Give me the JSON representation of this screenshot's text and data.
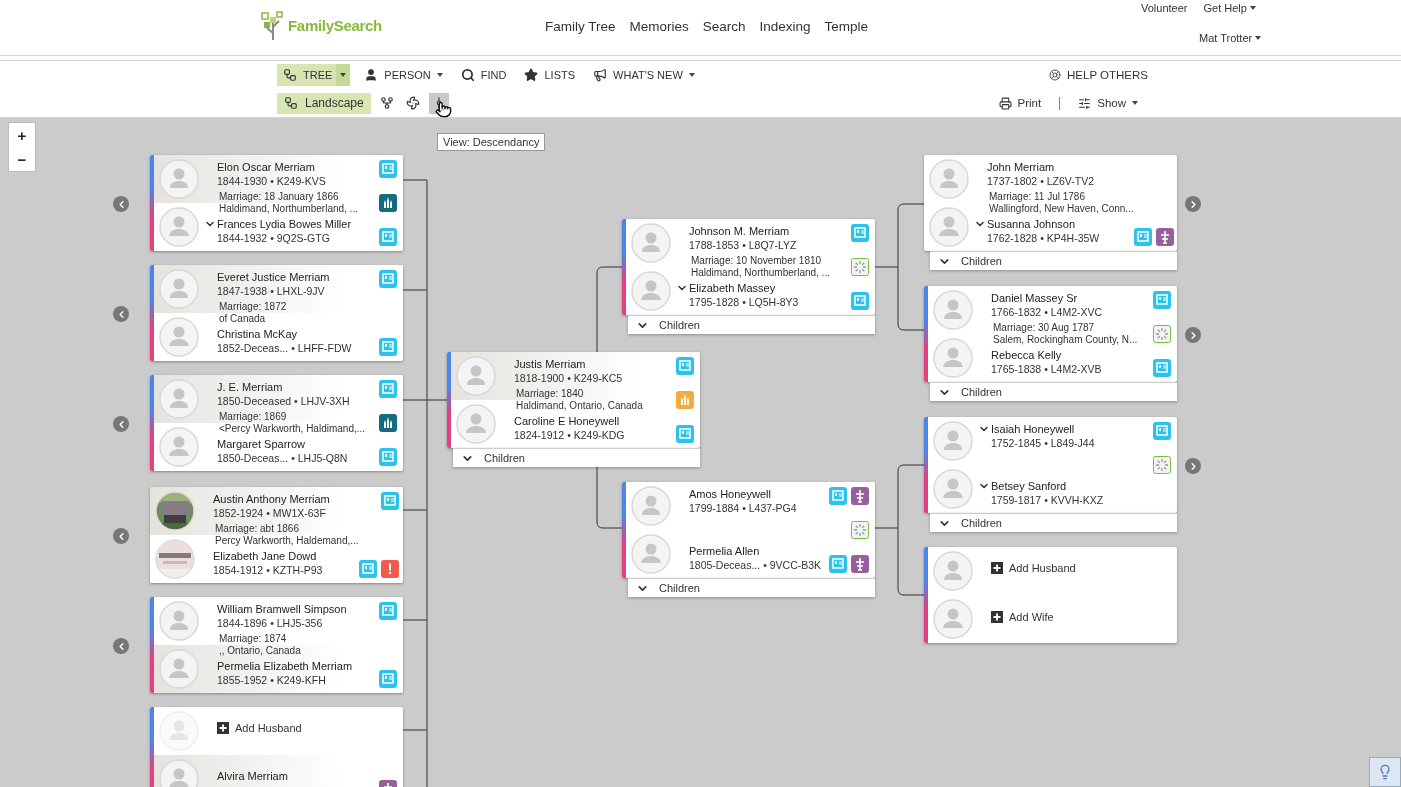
{
  "header": {
    "logo": "FamilySearch",
    "nav": [
      {
        "label": "Family Tree"
      },
      {
        "label": "Memories"
      },
      {
        "label": "Search"
      },
      {
        "label": "Indexing"
      },
      {
        "label": "Temple"
      }
    ],
    "utility": [
      {
        "label": "Volunteer",
        "menu": false
      },
      {
        "label": "Get Help",
        "menu": true
      }
    ],
    "user": {
      "label": "Mat Trotter",
      "menu": true
    }
  },
  "toolbar": {
    "items": [
      {
        "kind": "tree",
        "label": "TREE",
        "selected": true,
        "menu": true
      },
      {
        "kind": "person",
        "label": "PERSON",
        "selected": false,
        "menu": true
      },
      {
        "kind": "find",
        "label": "FIND",
        "selected": false,
        "menu": false
      },
      {
        "kind": "lists",
        "label": "LISTS",
        "selected": false,
        "menu": false
      },
      {
        "kind": "news",
        "label": "WHAT'S NEW",
        "selected": false,
        "menu": true
      }
    ],
    "help": "HELP OTHERS"
  },
  "viewbar": {
    "views": [
      {
        "kind": "landscape",
        "label": "Landscape",
        "selected": true,
        "hovered": false
      },
      {
        "kind": "portrait",
        "selected": false,
        "hovered": false
      },
      {
        "kind": "fan",
        "selected": false,
        "hovered": false
      },
      {
        "kind": "descendancy",
        "selected": false,
        "hovered": true
      }
    ],
    "print": "Print",
    "show": "Show"
  },
  "tooltip": "View: Descendancy",
  "zoom": [
    "+",
    "−"
  ],
  "tree": {
    "children_families": [
      {
        "arrow": {
          "kind": "left"
        },
        "husband": {
          "kind": "person",
          "name": "Elon Oscar Merriam",
          "info": "1844-1930 • K249-KVS",
          "avatar": {
            "kind": "silhouette"
          },
          "expand": false,
          "highlighted": true
        },
        "marriage": {
          "date": "Marriage: 18 January 1866",
          "place": "Haldimand, Northumberland, ..."
        },
        "wife": {
          "kind": "person",
          "name": "Frances Lydia Bowes Miller",
          "info": "1844-1932 • 9Q2S-GTG",
          "avatar": {
            "kind": "silhouette"
          },
          "expand": true,
          "highlighted": false
        },
        "icons": {
          "husband": [
            {
              "kind": "record"
            }
          ],
          "couple": [
            {
              "kind": "temple-done"
            }
          ],
          "wife": [
            {
              "kind": "record"
            }
          ]
        }
      },
      {
        "arrow": {
          "kind": "left"
        },
        "husband": {
          "kind": "person",
          "name": "Everet Justice Merriam",
          "info": "1847-1938 • LHXL-9JV",
          "avatar": {
            "kind": "silhouette"
          },
          "expand": false,
          "highlighted": true
        },
        "marriage": {
          "date": "Marriage: 1872",
          "place": "of Canada"
        },
        "wife": {
          "kind": "person",
          "name": "Christina McKay",
          "info": "1852-Deceas... • LHFF-FDW",
          "avatar": {
            "kind": "silhouette"
          },
          "expand": false,
          "highlighted": false
        },
        "icons": {
          "husband": [
            {
              "kind": "record"
            }
          ],
          "wife": [
            {
              "kind": "record"
            }
          ]
        }
      },
      {
        "arrow": {
          "kind": "left"
        },
        "husband": {
          "kind": "person",
          "name": "J. E. Merriam",
          "info": "1850-Deceased • LHJV-3XH",
          "avatar": {
            "kind": "silhouette"
          },
          "expand": false,
          "highlighted": true
        },
        "marriage": {
          "date": "Marriage: 1869",
          "place": "<Percy Warkworth, Haldimand,..."
        },
        "wife": {
          "kind": "person",
          "name": "Margaret Sparrow",
          "info": "1850-Deceas... • LHJ5-Q8N",
          "avatar": {
            "kind": "silhouette"
          },
          "expand": false,
          "highlighted": false
        },
        "icons": {
          "husband": [
            {
              "kind": "record"
            }
          ],
          "couple": [
            {
              "kind": "temple-done"
            }
          ],
          "wife": [
            {
              "kind": "record"
            }
          ]
        }
      },
      {
        "arrow": {
          "kind": "left"
        },
        "husband": {
          "kind": "person",
          "name": "Austin Anthony Merriam",
          "info": "1852-1924 • MW1X-63F",
          "expand": false,
          "highlighted": true
        },
        "marriage": {
          "date": "Marriage: abt 1866",
          "place": "Percy Warkworth, Haldemand,..."
        },
        "wife": {
          "kind": "person",
          "name": "Elizabeth Jane Dowd",
          "info": "1854-1912 • KZTH-P93",
          "expand": false,
          "highlighted": false
        },
        "icons": {
          "husband": [
            {
              "kind": "record"
            }
          ],
          "wife": [
            {
              "kind": "record"
            },
            {
              "kind": "alert"
            }
          ]
        }
      },
      {
        "arrow": {
          "kind": "left"
        },
        "husband": {
          "kind": "person",
          "name": "William Bramwell Simpson",
          "info": "1844-1896 • LHJ5-356",
          "avatar": {
            "kind": "silhouette"
          },
          "expand": false,
          "highlighted": false
        },
        "marriage": {
          "date": "Marriage: 1874",
          "place": ",, Ontario, Canada"
        },
        "wife": {
          "kind": "person",
          "name": "Permelia Elizabeth Merriam",
          "info": "1855-1952 • K249-KFH",
          "avatar": {
            "kind": "silhouette"
          },
          "expand": false,
          "highlighted": true
        },
        "icons": {
          "husband": [
            {
              "kind": "record"
            }
          ],
          "wife": [
            {
              "kind": "record"
            }
          ]
        }
      },
      {
        "husband": {
          "kind": "add",
          "label": "Add Husband",
          "avatar": {
            "kind": "faded"
          }
        },
        "wife": {
          "kind": "person",
          "name": "Alvira Merriam",
          "avatar": {
            "kind": "silhouette"
          },
          "expand": false,
          "highlighted": true
        },
        "icons": {
          "wife": [
            {
              "kind": "tree"
            }
          ]
        }
      }
    ],
    "root_family": {
      "children": "Children",
      "husband": {
        "kind": "person",
        "name": "Justis Merriam",
        "info": "1818-1900 • K249-KC5",
        "avatar": {
          "kind": "silhouette"
        },
        "expand": false,
        "highlighted": true
      },
      "marriage": {
        "date": "Marriage: 1840",
        "place": "Haldimand, Ontario, Canada"
      },
      "wife": {
        "kind": "person",
        "name": "Caroline E Honeywell",
        "info": "1824-1912 • K249-KDG",
        "avatar": {
          "kind": "silhouette"
        },
        "expand": false,
        "highlighted": false
      },
      "icons": {
        "husband": [
          {
            "kind": "record"
          }
        ],
        "couple": [
          {
            "kind": "temple-ready"
          }
        ],
        "wife": [
          {
            "kind": "record"
          }
        ]
      }
    },
    "parent_families": [
      {
        "children": "Children",
        "husband": {
          "kind": "person",
          "name": "Johnson M. Merriam",
          "info": "1788-1853 • L8Q7-LYZ",
          "avatar": {
            "kind": "silhouette"
          },
          "expand": false,
          "highlighted": false
        },
        "marriage": {
          "date": "Marriage: 10 November 1810",
          "place": "Haldimand, Northumberland, ..."
        },
        "wife": {
          "kind": "person",
          "name": "Elizabeth Massey",
          "info": "1795-1828 • LQ5H-8Y3",
          "avatar": {
            "kind": "silhouette"
          },
          "expand": true,
          "highlighted": false
        },
        "icons": {
          "husband": [
            {
              "kind": "record"
            }
          ],
          "couple": [
            {
              "kind": "wait"
            }
          ],
          "wife": [
            {
              "kind": "record"
            }
          ]
        }
      },
      {
        "children": "Children",
        "husband": {
          "kind": "person",
          "name": "Amos Honeywell",
          "info": "1799-1884 • L437-PG4",
          "avatar": {
            "kind": "silhouette"
          },
          "expand": false,
          "highlighted": false
        },
        "wife": {
          "kind": "person",
          "name": "Permelia Allen",
          "info": "1805-Deceas... • 9VCC-B3K",
          "avatar": {
            "kind": "silhouette"
          },
          "expand": false,
          "highlighted": false
        },
        "icons": {
          "husband": [
            {
              "kind": "record"
            },
            {
              "kind": "tree"
            }
          ],
          "couple": [
            {
              "kind": "wait"
            }
          ],
          "wife": [
            {
              "kind": "record"
            },
            {
              "kind": "tree"
            }
          ]
        }
      }
    ],
    "grandparent_families": [
      {
        "arrow": {
          "kind": "right"
        },
        "children": "Children",
        "husband": {
          "kind": "person",
          "name": "John Merriam",
          "info": "1737-1802 • LZ6V-TV2",
          "avatar": {
            "kind": "silhouette"
          },
          "expand": false,
          "highlighted": false
        },
        "marriage": {
          "date": "Marriage: 11 Jul 1786",
          "place": "Wallingford, New Haven, Conn..."
        },
        "wife": {
          "kind": "person",
          "name": "Susanna Johnson",
          "info": "1762-1828 • KP4H-35W",
          "avatar": {
            "kind": "silhouette"
          },
          "expand": true,
          "highlighted": false
        },
        "icons": {
          "wife": [
            {
              "kind": "record"
            },
            {
              "kind": "tree"
            }
          ]
        }
      },
      {
        "arrow": {
          "kind": "right"
        },
        "children": "Children",
        "husband": {
          "kind": "person",
          "name": "Daniel Massey Sr",
          "info": "1766-1832 • L4M2-XVC",
          "avatar": {
            "kind": "silhouette"
          },
          "expand": false,
          "highlighted": false
        },
        "marriage": {
          "date": "Marriage: 30 Aug 1787",
          "place": "Salem, Rockingham County, N..."
        },
        "wife": {
          "kind": "person",
          "name": "Rebecca Kelly",
          "info": "1765-1838 • L4M2-XVB",
          "avatar": {
            "kind": "silhouette"
          },
          "expand": false,
          "highlighted": false
        },
        "icons": {
          "husband": [
            {
              "kind": "record"
            }
          ],
          "couple": [
            {
              "kind": "wait"
            }
          ],
          "wife": [
            {
              "kind": "record"
            }
          ]
        }
      },
      {
        "arrow": {
          "kind": "right"
        },
        "children": "Children",
        "husband": {
          "kind": "person",
          "name": "Isaiah Honeywell",
          "info": "1752-1845 • L849-J44",
          "avatar": {
            "kind": "silhouette"
          },
          "expand": true,
          "highlighted": false
        },
        "wife": {
          "kind": "person",
          "name": "Betsey Sanford",
          "info": "1759-1817 • KVVH-KXZ",
          "avatar": {
            "kind": "silhouette"
          },
          "expand": true,
          "highlighted": false
        },
        "icons": {
          "husband": [
            {
              "kind": "record"
            }
          ],
          "couple": [
            {
              "kind": "wait"
            }
          ]
        }
      },
      {
        "husband": {
          "kind": "add",
          "label": "Add Husband",
          "avatar": {
            "kind": "silhouette"
          }
        },
        "wife": {
          "kind": "add",
          "label": "Add Wife",
          "avatar": {
            "kind": "silhouette"
          }
        }
      }
    ]
  }
}
